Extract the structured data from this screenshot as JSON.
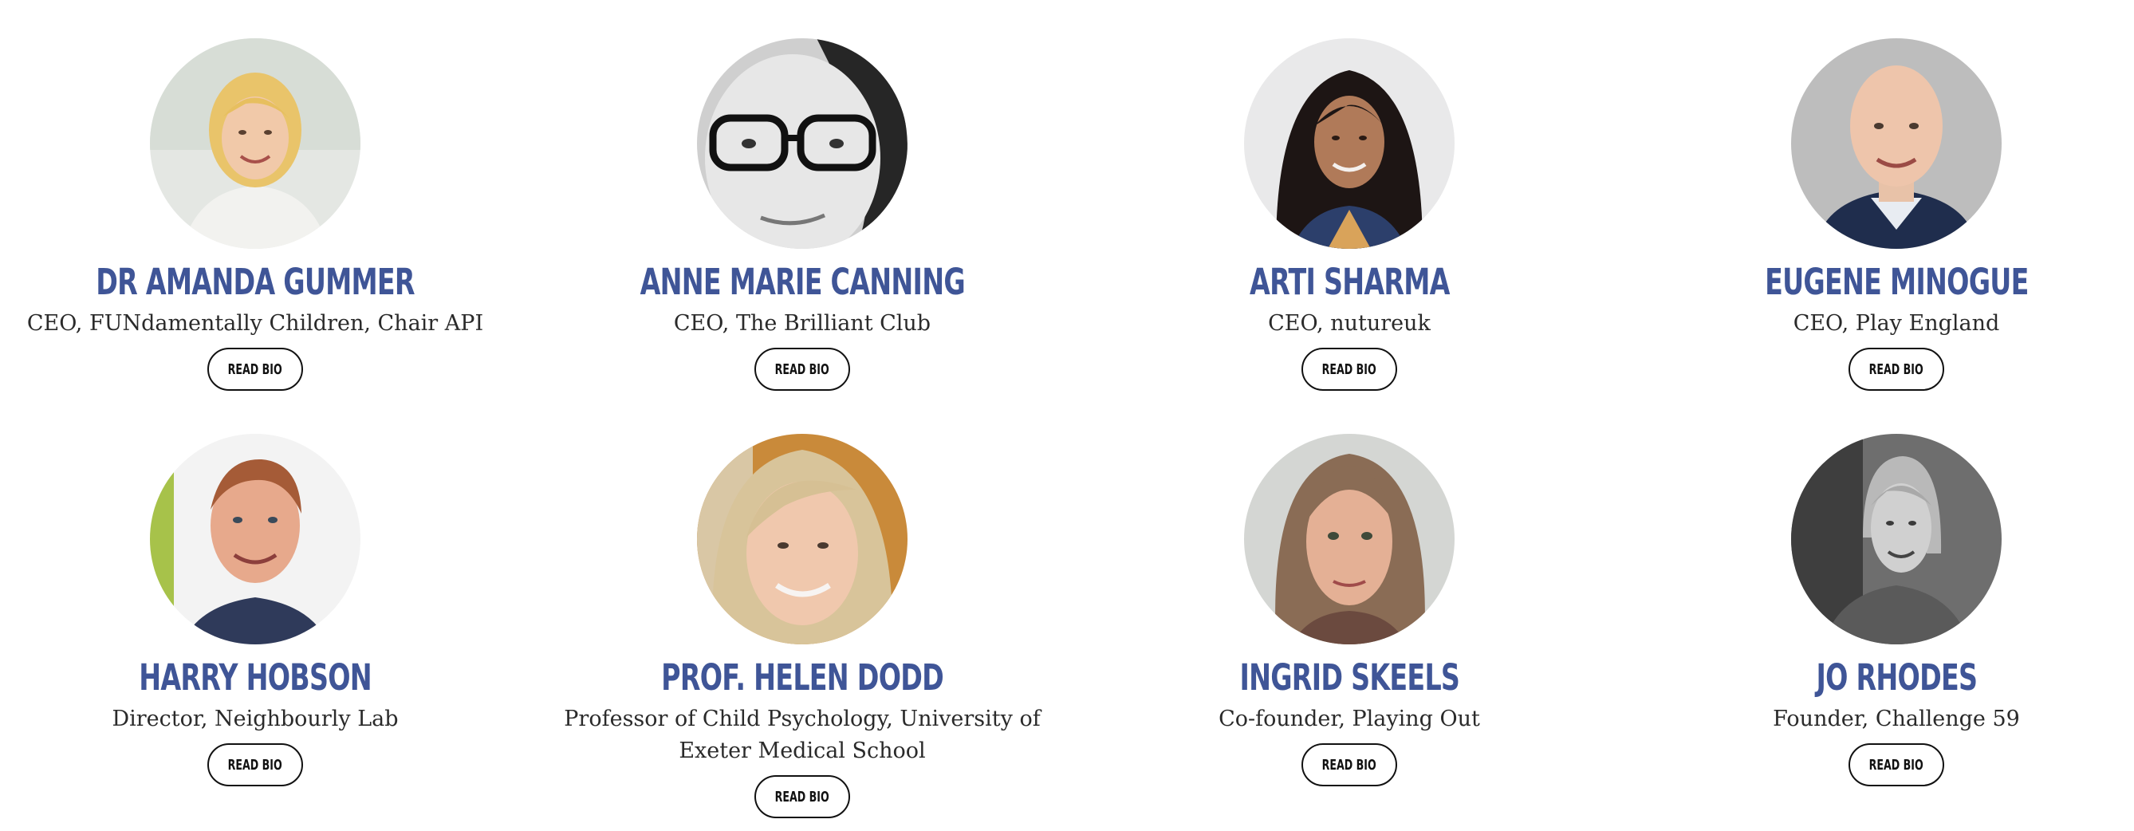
{
  "people": [
    {
      "name": "DR AMANDA GUMMER",
      "role": "CEO, FUNdamentally Children, Chair API",
      "button": "READ BIO",
      "photo": "amanda-gummer-photo"
    },
    {
      "name": "ANNE MARIE CANNING",
      "role": "CEO, The Brilliant Club",
      "button": "READ BIO",
      "photo": "anne-marie-canning-photo"
    },
    {
      "name": "ARTI SHARMA",
      "role": "CEO, nutureuk",
      "button": "READ BIO",
      "photo": "arti-sharma-photo"
    },
    {
      "name": "EUGENE MINOGUE",
      "role": "CEO, Play England",
      "button": "READ BIO",
      "photo": "eugene-minogue-photo"
    },
    {
      "name": "HARRY HOBSON",
      "role": "Director, Neighbourly Lab",
      "button": "READ BIO",
      "photo": "harry-hobson-photo"
    },
    {
      "name": "PROF. HELEN DODD",
      "role": "Professor of Child Psychology, University of Exeter Medical School",
      "button": "READ BIO",
      "photo": "helen-dodd-photo"
    },
    {
      "name": "INGRID SKEELS",
      "role": "Co-founder, Playing Out",
      "button": "READ BIO",
      "photo": "ingrid-skeels-photo"
    },
    {
      "name": "JO RHODES",
      "role": "Founder, Challenge 59",
      "button": "READ BIO",
      "photo": "jo-rhodes-photo"
    }
  ],
  "colors": {
    "name_text": "#3f5597",
    "role_text": "#2a2a2a",
    "button_border": "#111111"
  }
}
